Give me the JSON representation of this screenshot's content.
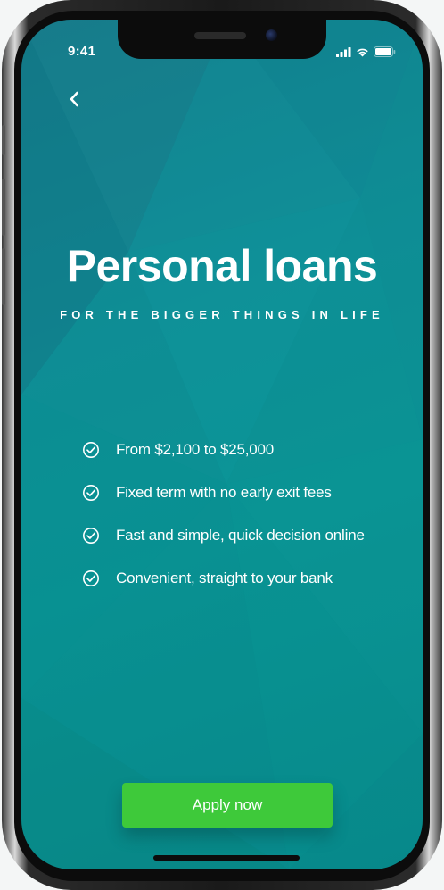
{
  "status_bar": {
    "time": "9:41",
    "icons": [
      "signal-icon",
      "wifi-icon",
      "battery-icon"
    ]
  },
  "nav": {
    "back_icon": "chevron-left-icon"
  },
  "hero": {
    "title": "Personal loans",
    "subtitle": "FOR THE BIGGER THINGS IN LIFE"
  },
  "features": [
    {
      "icon": "check-circle-icon",
      "text": "From $2,100 to $25,000"
    },
    {
      "icon": "check-circle-icon",
      "text": "Fixed term with no early exit fees"
    },
    {
      "icon": "check-circle-icon",
      "text": "Fast and simple, quick decision online"
    },
    {
      "icon": "check-circle-icon",
      "text": "Convenient, straight to your bank"
    }
  ],
  "cta": {
    "label": "Apply now"
  },
  "colors": {
    "background_teal": "#0a9494",
    "button_green": "#3ec93a",
    "text": "#ffffff"
  }
}
